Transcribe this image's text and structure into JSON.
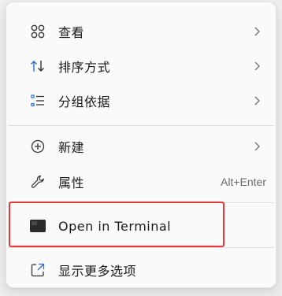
{
  "context_menu": {
    "items": [
      {
        "label": "查看",
        "icon": "grid-view-icon",
        "has_submenu": true
      },
      {
        "label": "排序方式",
        "icon": "sort-arrows-icon",
        "has_submenu": true
      },
      {
        "label": "分组依据",
        "icon": "group-list-icon",
        "has_submenu": true
      },
      {
        "label": "新建",
        "icon": "plus-circle-icon",
        "has_submenu": true
      },
      {
        "label": "属性",
        "icon": "wrench-icon",
        "shortcut": "Alt+Enter"
      },
      {
        "label": "Open in Terminal",
        "icon": "terminal-icon"
      },
      {
        "label": "显示更多选项",
        "icon": "expand-window-icon"
      }
    ],
    "highlight_color": "#e53935"
  }
}
